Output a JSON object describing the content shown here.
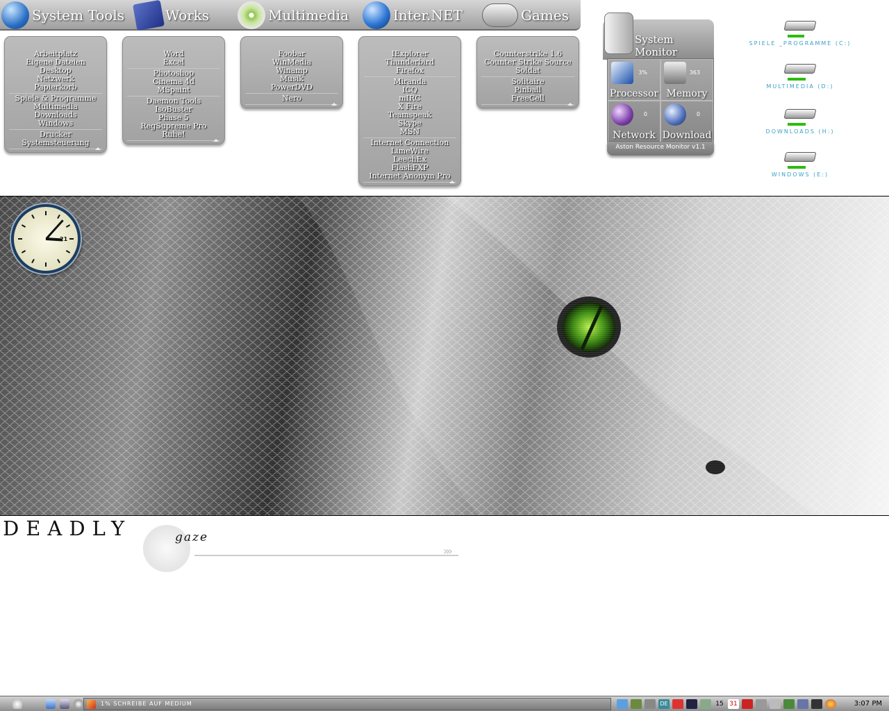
{
  "categories": [
    {
      "name": "System Tools",
      "icon": "apple-icon"
    },
    {
      "name": "Works",
      "icon": "notepad-icon"
    },
    {
      "name": "Multimedia",
      "icon": "itunes-icon"
    },
    {
      "name": "Inter.NET",
      "icon": "globe-icon"
    },
    {
      "name": "Games",
      "icon": "gamepad-icon"
    }
  ],
  "menus": {
    "system_tools": [
      [
        "Arbeitplatz",
        "Eigene Dateien",
        "Desktop",
        "Netzwerk",
        "Papierkorb"
      ],
      [
        "Spiele & Programme",
        "Multimedia",
        "Downloads",
        "Windows"
      ],
      [
        "Drucker",
        "Systemsteuerung"
      ]
    ],
    "works": [
      [
        "Word",
        "Excel"
      ],
      [
        "Photoshop",
        "Cinema 4d",
        "MSpaint"
      ],
      [
        "Daemon Tools",
        "IsoBuster",
        "Phase 5",
        "RegSupreme Pro",
        "Ruhe!"
      ]
    ],
    "multimedia": [
      [
        "Foobar",
        "WinMedia",
        "Winamp",
        "Musik",
        "PowerDVD"
      ],
      [
        "Nero"
      ]
    ],
    "internet": [
      [
        "IExplorer",
        "Thunderbird",
        "Firefox"
      ],
      [
        "Miranda",
        "ICQ",
        "mIRC",
        "X Fire",
        "Teamspeak",
        "Skype",
        "MSN"
      ],
      [
        "Internet Connection",
        "LimeWire",
        "LeechEx",
        "FlashFXP",
        "Internet Anonym Pro"
      ]
    ],
    "games": [
      [
        "Counterstrike 1.6",
        "Counter Strike Source",
        "Soldat"
      ],
      [
        "Solitaire",
        "Pinball",
        "FreeCell"
      ]
    ]
  },
  "monitor": {
    "title": "System Monitor",
    "processor": {
      "label": "Processor",
      "value": "3%"
    },
    "memory": {
      "label": "Memory",
      "value": "363"
    },
    "network": {
      "label": "Network",
      "value": "0"
    },
    "download": {
      "label": "Download",
      "value": "0"
    },
    "footer": "Aston Resource Monitor v1.1"
  },
  "drives": [
    {
      "label": "SPIELE _PROGRAMME (C:)",
      "usage": 0.5
    },
    {
      "label": "MULTIMEDIA (D:)",
      "usage": 0.55
    },
    {
      "label": "DOWNLOADS (H:)",
      "usage": 0.55
    },
    {
      "label": "WINDOWS (E:)",
      "usage": 0.55
    }
  ],
  "clock": {
    "hour": 3,
    "minute": 7,
    "date": "21"
  },
  "wallpaper": {
    "title": "DEADLY",
    "subtitle": "gaze"
  },
  "taskbar": {
    "active_task": "1% SCHREIBE AUF MEDIUM",
    "time": "3:07 PM",
    "tray_lang": "DE",
    "tray_counter": "15",
    "tray_date": "31"
  },
  "colors": {
    "accent_drive_bar": "#2bbd10",
    "drive_label": "#3aa0c8",
    "clock_border": "#1d3d60"
  }
}
